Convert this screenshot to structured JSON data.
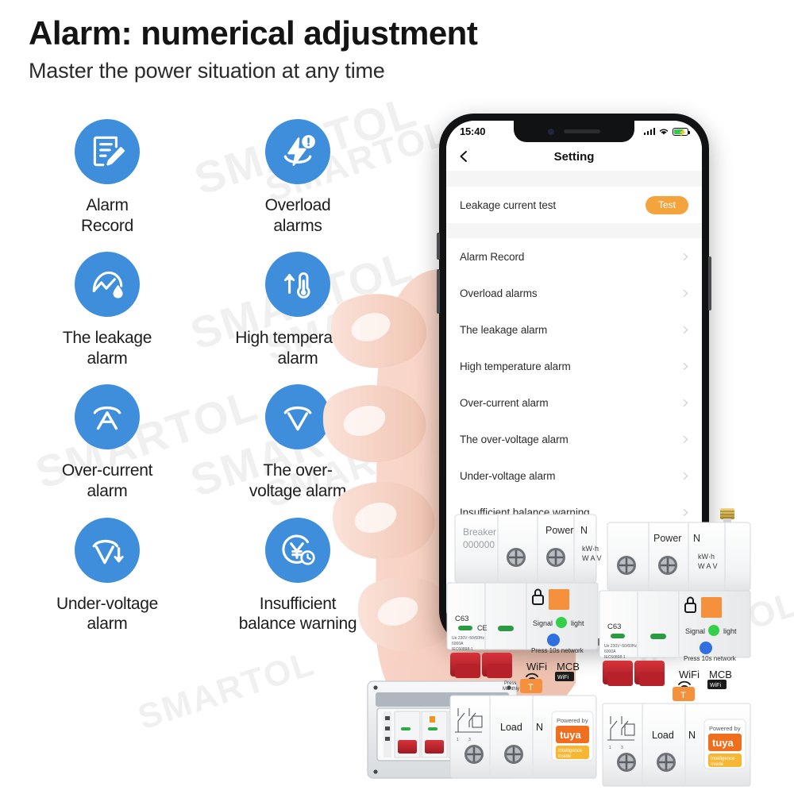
{
  "header": {
    "title": "Alarm: numerical adjustment",
    "subtitle": "Master the power situation at any time"
  },
  "colors": {
    "accent_blue": "#3f8edc",
    "orange": "#f5a33c",
    "breaker_red": "#c1242c",
    "led_green": "#35d04a",
    "led_blue": "#2f6fe0",
    "tuya_orange": "#f06f1e",
    "tuya_yellow": "#f7b733"
  },
  "watermark": {
    "text": "SMARTOL"
  },
  "features": [
    {
      "label": "Alarm\nRecord",
      "icon": "document-pencil-icon"
    },
    {
      "label": "Overload\nalarms",
      "icon": "lightning-alert-icon"
    },
    {
      "label": "The leakage\nalarm",
      "icon": "gauge-droplet-icon"
    },
    {
      "label": "High temperature\nalarm",
      "icon": "thermometer-up-icon"
    },
    {
      "label": "Over-current\nalarm",
      "icon": "ampere-arc-icon"
    },
    {
      "label": "The over-\nvoltage alarm",
      "icon": "volt-arc-icon"
    },
    {
      "label": "Under-voltage\nalarm",
      "icon": "volt-down-arrow-icon"
    },
    {
      "label": "Insufficient\nbalance warning",
      "icon": "yen-clock-icon"
    }
  ],
  "phone": {
    "status": {
      "time": "15:40",
      "signal": "signal-bars-icon",
      "wifi": "wifi-icon",
      "battery": "battery-charging-icon"
    },
    "nav": {
      "back": "back-chevron-icon",
      "title": "Setting"
    },
    "leakage_test": {
      "label": "Leakage current test",
      "button": "Test"
    },
    "menu": [
      {
        "label": "Alarm Record"
      },
      {
        "label": "Overload alarms"
      },
      {
        "label": "The leakage alarm"
      },
      {
        "label": "High temperature alarm"
      },
      {
        "label": "Over-current alarm"
      },
      {
        "label": "The over-voltage alarm"
      },
      {
        "label": "Under-voltage alarm"
      },
      {
        "label": "Insufficient balance warning"
      }
    ]
  },
  "device": {
    "breaker_label": "Breaker",
    "breaker_serial": "000000",
    "power_label": "Power",
    "neutral_label": "N",
    "meter_unit": "kW·h",
    "meter_symbols": "W A V",
    "rating": "C63",
    "spec_line1": "Ue 230V~50/60Hz",
    "spec_line2": "6000A",
    "spec_line3": "IEC60898-1",
    "signal_label": "Signal",
    "light_label": "light",
    "network_label": "Press 10s network",
    "wifi_label": "WiFi",
    "mcb_label": "MCB",
    "test_label": "Press\nMonthly",
    "test_button": "T",
    "load_label": "Load",
    "load_neutral": "N",
    "tuya": {
      "powered_by": "Powered by",
      "brand": "tuya",
      "tagline_line1": "Intelligence",
      "tagline_line2": "Inside"
    }
  }
}
